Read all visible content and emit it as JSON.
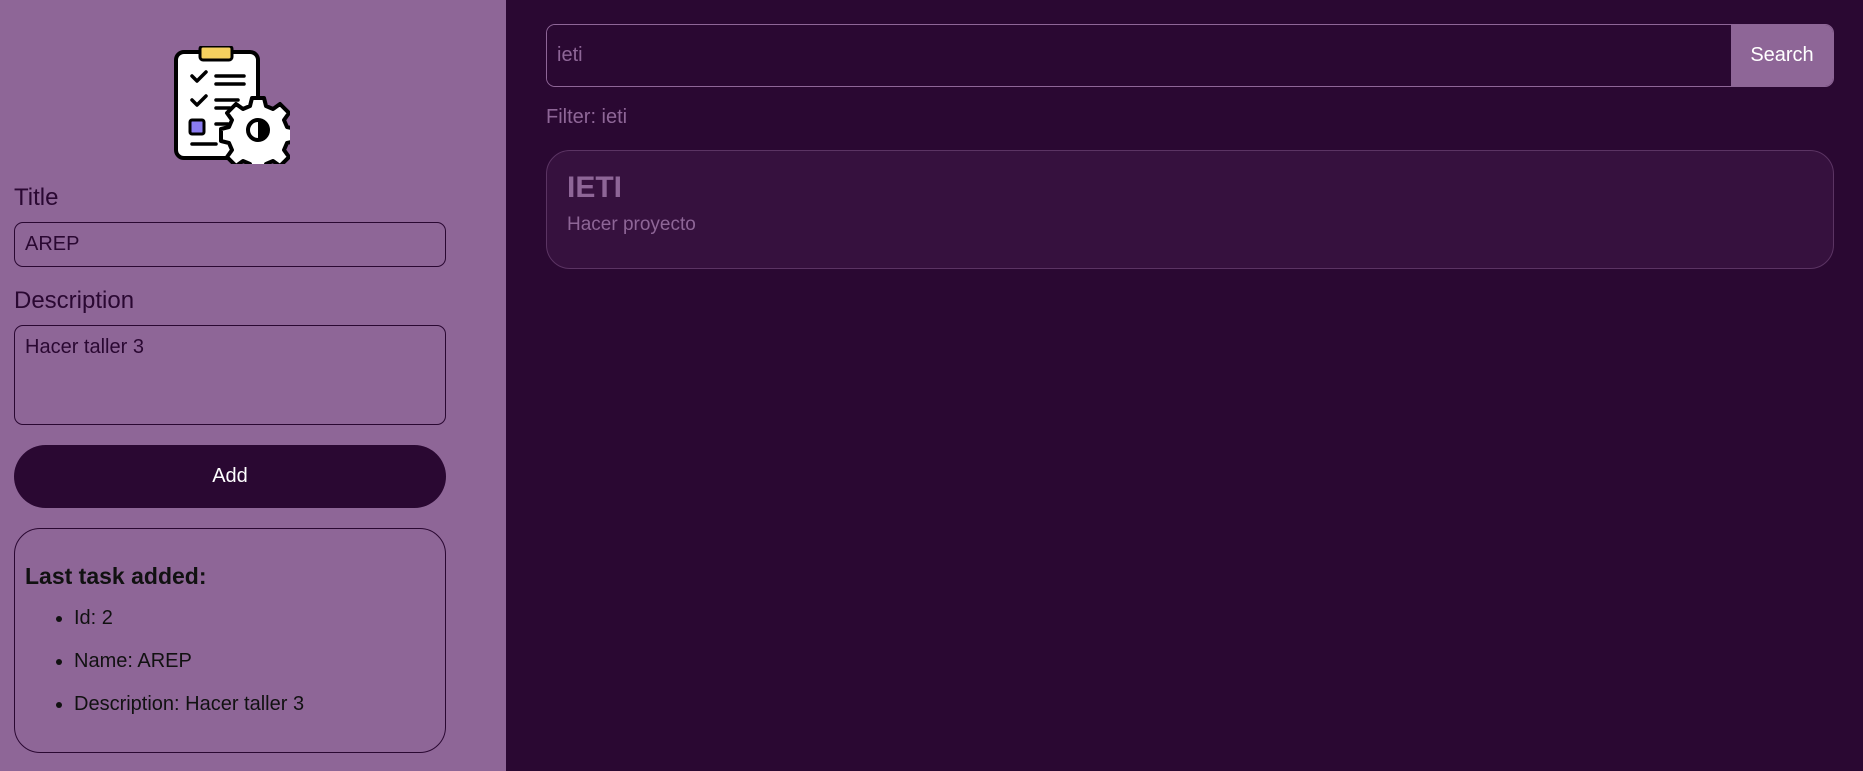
{
  "sidebar": {
    "logo_icon": "clipboard-settings-icon",
    "title_label": "Title",
    "title_value": "AREP",
    "description_label": "Description",
    "description_value": "Hacer taller 3",
    "add_label": "Add",
    "last_task": {
      "heading": "Last task added:",
      "id": "Id: 2",
      "name": "Name: AREP",
      "description": "Description: Hacer taller 3"
    }
  },
  "main": {
    "search_value": "ieti",
    "search_label": "Search",
    "filter_text": "Filter: ieti",
    "tasks": [
      {
        "title": "IETI",
        "description": "Hacer proyecto"
      }
    ]
  },
  "colors": {
    "sidebar_bg": "#8e6697",
    "main_bg": "#2a0832",
    "card_bg": "#36113e",
    "accent": "#8e6697"
  }
}
